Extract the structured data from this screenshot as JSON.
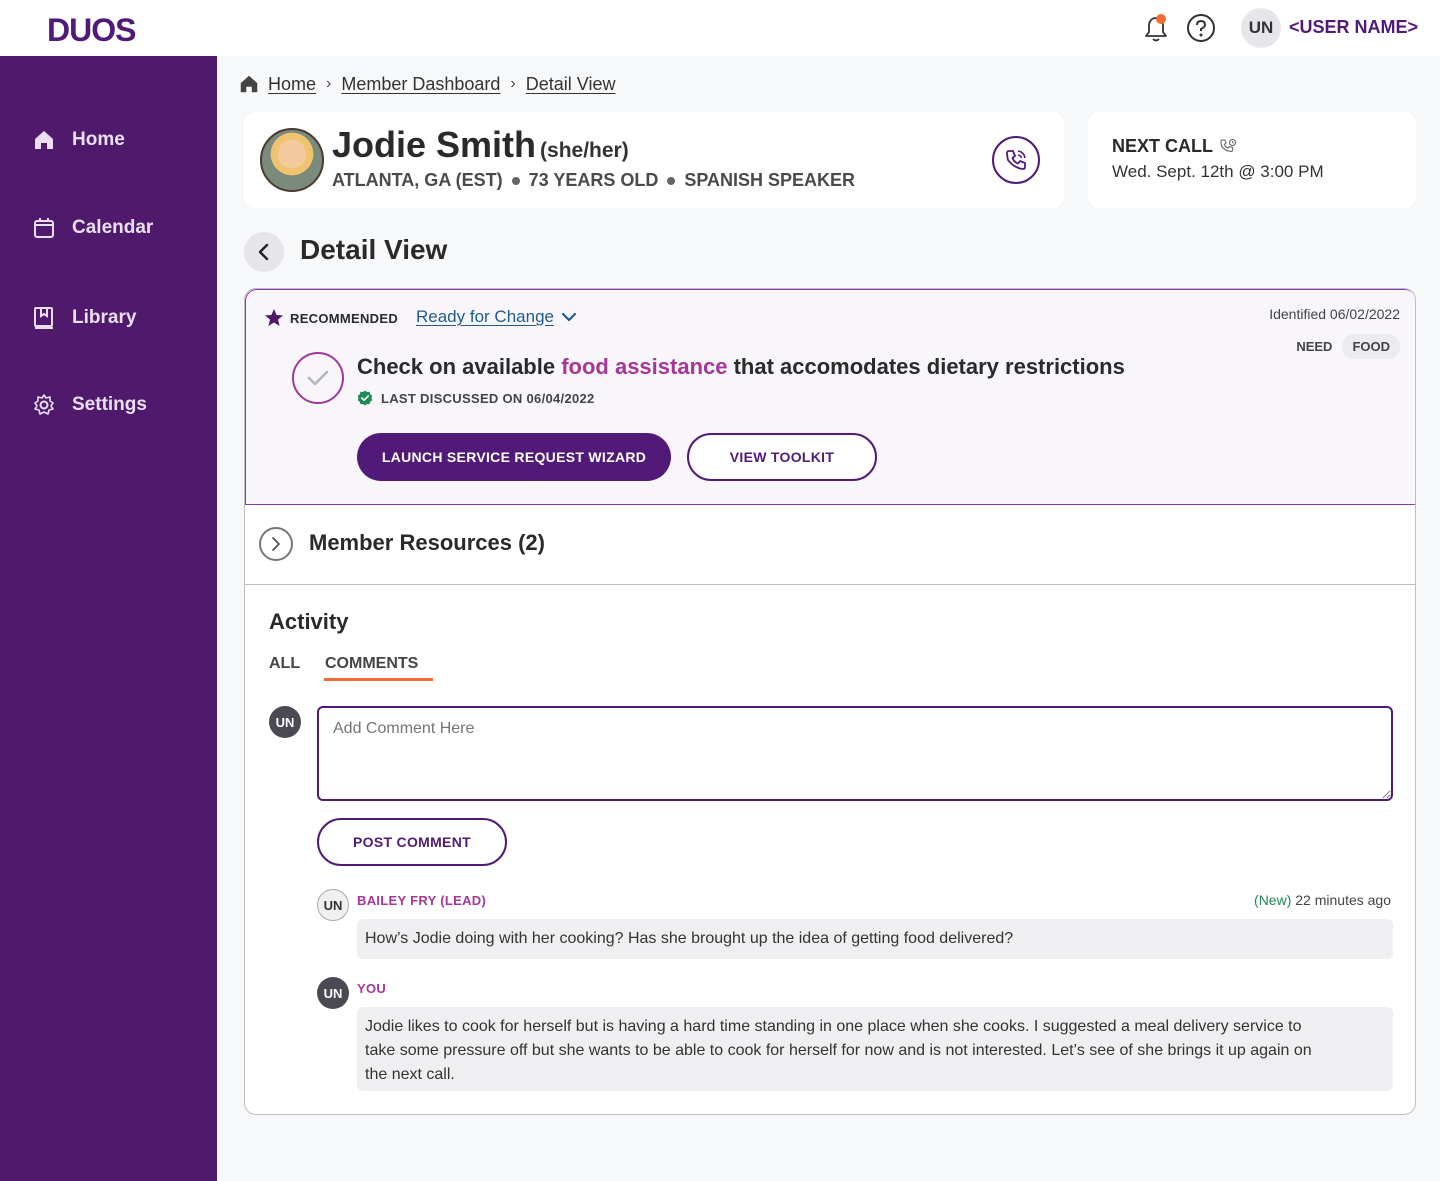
{
  "app": {
    "logo": "DUOS"
  },
  "header": {
    "avatar_initials": "UN",
    "username": "<USER NAME>"
  },
  "sidebar": {
    "items": [
      {
        "label": "Home",
        "icon": "home-icon"
      },
      {
        "label": "Calendar",
        "icon": "calendar-icon"
      },
      {
        "label": "Library",
        "icon": "library-icon"
      },
      {
        "label": "Settings",
        "icon": "gear-icon"
      }
    ]
  },
  "breadcrumb": [
    "Home",
    "Member Dashboard",
    "Detail View"
  ],
  "member": {
    "name": "Jodie Smith",
    "pronouns": "(she/her)",
    "location": "ATLANTA, GA (EST)",
    "age": "73 YEARS OLD",
    "language": "SPANISH SPEAKER"
  },
  "next_call": {
    "title": "NEXT CALL",
    "date": "Wed. Sept. 12th @ 3:00 PM"
  },
  "detail": {
    "title": "Detail View"
  },
  "recommendation": {
    "badge": "RECOMMENDED",
    "stage": "Ready for Change",
    "identified": "Identified 06/02/2022",
    "tag_label": "NEED",
    "tag_value": "FOOD",
    "goal_prefix": "Check on available ",
    "goal_highlight": "food assistance",
    "goal_suffix": " that accomodates dietary restrictions",
    "last_discussed": "LAST DISCUSSED ON 06/04/2022",
    "primary_button": "LAUNCH SERVICE REQUEST WIZARD",
    "secondary_button": "VIEW TOOLKIT"
  },
  "resources": {
    "title": "Member Resources (2)"
  },
  "activity": {
    "title": "Activity",
    "tabs": [
      "ALL",
      "COMMENTS"
    ],
    "active_tab": "COMMENTS",
    "avatar_initials": "UN",
    "comment_placeholder": "Add Comment Here",
    "post_button": "POST COMMENT",
    "comments": [
      {
        "initials": "UN",
        "author": "BAILEY FRY (LEAD)",
        "new_label": "(New)",
        "time": "22 minutes ago",
        "text": "How’s Jodie doing with her cooking? Has she brought up the idea of getting food delivered?"
      },
      {
        "initials": "UN",
        "author": "YOU",
        "text": "Jodie likes to cook for herself but is having a hard time standing in one place when she cooks. I suggested a meal delivery service to take some pressure off but she wants to be able to cook for herself for now and is not interested. Let’s see of she brings it up again on the next call."
      }
    ]
  },
  "colors": {
    "brand": "#521a78",
    "sidebar": "#4f1a6b",
    "accent": "#a4369c",
    "tab_underline": "#f36b32",
    "new": "#1e8a56"
  }
}
